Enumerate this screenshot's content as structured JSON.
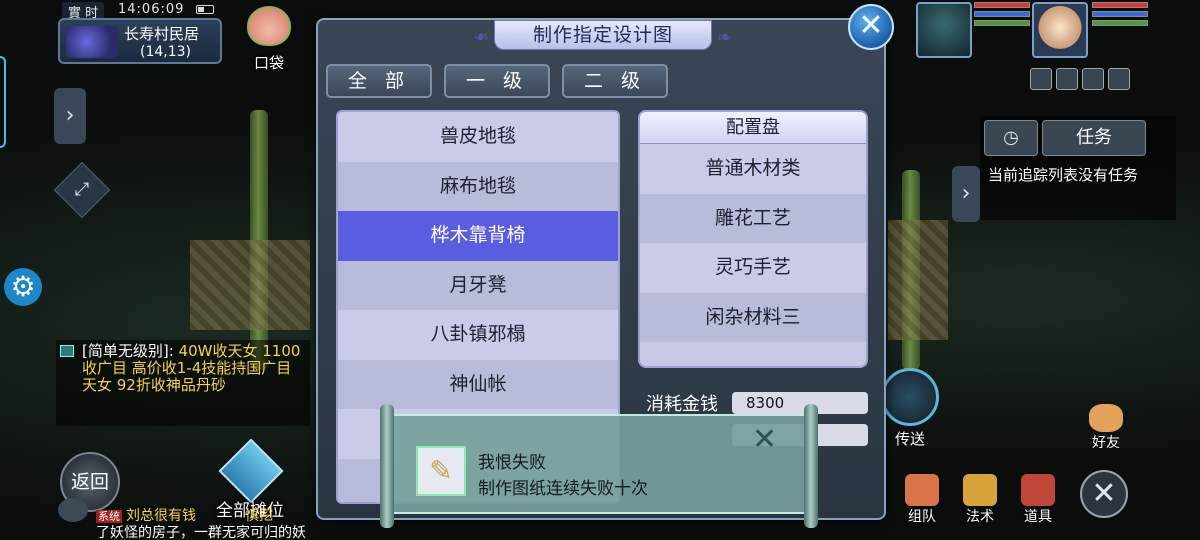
{
  "status": {
    "time_tag": "實 时",
    "clock": "14:06:09"
  },
  "location": {
    "name": "长寿村民居",
    "coords": "(14,13)"
  },
  "bag": {
    "label": "口袋"
  },
  "chat": {
    "channel_text": "[简单无级别]:",
    "message": "40W收天女 1100收广目 高价收1-4技能持国广目天女 92折收神品丹砂"
  },
  "bottom_chat": {
    "tag": "系统",
    "line1": "刘总很有钱",
    "line1_tail": "慎挖",
    "line2": "了妖怪的房子，一群无家可归的妖"
  },
  "left_buttons": {
    "back": "返回",
    "stall": "全部摊位"
  },
  "dialog": {
    "title": "制作指定设计图",
    "tabs": [
      "全 部",
      "一 级",
      "二 级"
    ],
    "designs": [
      "兽皮地毯",
      "麻布地毯",
      "桦木靠背椅",
      "月牙凳",
      "八卦镇邪榻",
      "神仙帐",
      "",
      ""
    ],
    "selected_index": 2,
    "config_header": "配置盘",
    "config_items": [
      "普通木材类",
      "雕花工艺",
      "灵巧手艺",
      "闲杂材料三"
    ],
    "cost_label": "消耗金钱",
    "cost_value": "8300"
  },
  "toast": {
    "title": "我恨失败",
    "subtitle": "制作图纸连续失败十次"
  },
  "task_panel": {
    "button": "任务",
    "empty_text": "当前追踪列表没有任务"
  },
  "right_buttons": {
    "teleport": "传送",
    "friend": "好友",
    "team": "组队",
    "magic": "法术",
    "items": "道具"
  }
}
